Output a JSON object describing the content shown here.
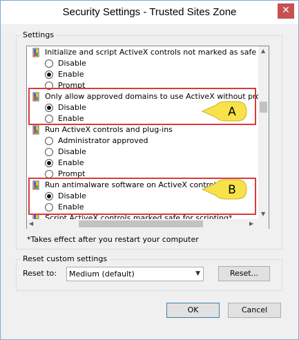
{
  "window": {
    "title": "Security Settings - Trusted Sites Zone",
    "close_glyph": "✕"
  },
  "settings": {
    "group_label": "Settings",
    "items": [
      {
        "type": "heading",
        "label": "Initialize and script ActiveX controls not marked as safe for scripti",
        "icon": "setting-shield-icon"
      },
      {
        "type": "option",
        "label": "Disable",
        "checked": false
      },
      {
        "type": "option",
        "label": "Enable",
        "checked": true
      },
      {
        "type": "option",
        "label": "Prompt",
        "checked": false
      },
      {
        "type": "heading",
        "label": "Only allow approved domains to use ActiveX without prompt",
        "icon": "setting-shield-icon"
      },
      {
        "type": "option",
        "label": "Disable",
        "checked": true
      },
      {
        "type": "option",
        "label": "Enable",
        "checked": false
      },
      {
        "type": "heading",
        "label": "Run ActiveX controls and plug-ins",
        "icon": "setting-shield-icon"
      },
      {
        "type": "option",
        "label": "Administrator approved",
        "checked": false
      },
      {
        "type": "option",
        "label": "Disable",
        "checked": false
      },
      {
        "type": "option",
        "label": "Enable",
        "checked": true
      },
      {
        "type": "option",
        "label": "Prompt",
        "checked": false
      },
      {
        "type": "heading",
        "label": "Run antimalware software on ActiveX controls",
        "icon": "setting-shield-icon"
      },
      {
        "type": "option",
        "label": "Disable",
        "checked": true
      },
      {
        "type": "option",
        "label": "Enable",
        "checked": false
      },
      {
        "type": "heading",
        "label": "Script ActiveX controls marked safe for scripting*",
        "icon": "setting-shield-icon"
      }
    ],
    "note": "*Takes effect after you restart your computer"
  },
  "annotations": {
    "callout_a": "A",
    "callout_b": "B",
    "highlight_color": "#d93a3a",
    "callout_color": "#f7e24b"
  },
  "reset": {
    "group_label": "Reset custom settings",
    "reset_to_label": "Reset to:",
    "selected": "Medium (default)",
    "reset_button": "Reset..."
  },
  "footer": {
    "ok": "OK",
    "cancel": "Cancel"
  }
}
